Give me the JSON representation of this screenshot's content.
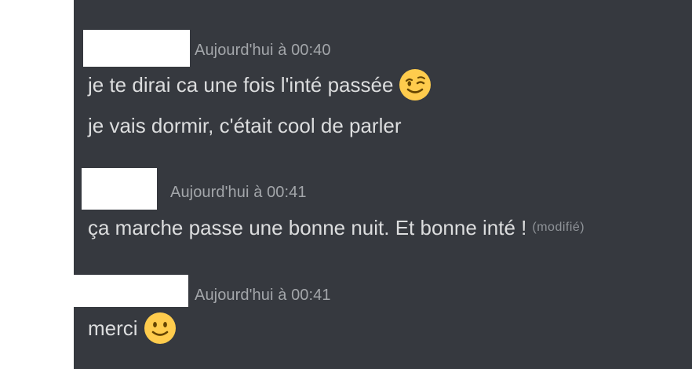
{
  "messages": [
    {
      "timestamp": "Aujourd'hui à 00:40",
      "lines": [
        {
          "text": "je te dirai ca une fois l'inté passée",
          "emoji": "winking-face-icon"
        },
        {
          "text": "je vais dormir, c'était cool de parler"
        }
      ]
    },
    {
      "timestamp": "Aujourd'hui à 00:41",
      "lines": [
        {
          "text": "ça marche passe une bonne nuit. Et bonne inté !",
          "edited": "(modifié)"
        }
      ]
    },
    {
      "timestamp": "Aujourd'hui à 00:41",
      "lines": [
        {
          "text": "merci",
          "emoji": "slightly-smiling-face-icon"
        }
      ]
    }
  ],
  "colors": {
    "panel_background": "#36393f",
    "message_text": "#dcddde",
    "timestamp_text": "#a3a6aa",
    "emoji_yellow": "#ffcc4d"
  }
}
